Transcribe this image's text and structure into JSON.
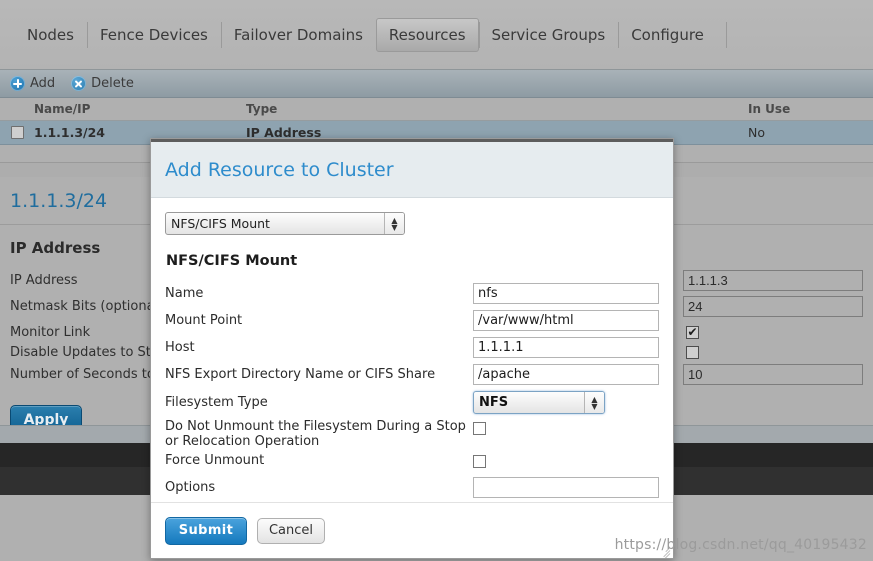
{
  "tabs": [
    {
      "label": "Nodes",
      "active": false
    },
    {
      "label": "Fence Devices",
      "active": false
    },
    {
      "label": "Failover Domains",
      "active": false
    },
    {
      "label": "Resources",
      "active": true
    },
    {
      "label": "Service Groups",
      "active": false
    },
    {
      "label": "Configure",
      "active": false
    }
  ],
  "toolbar": {
    "add_label": "Add",
    "delete_label": "Delete",
    "add_icon": "plus-circle-icon",
    "delete_icon": "x-circle-icon"
  },
  "table": {
    "columns": [
      "Name/IP",
      "Type",
      "In Use"
    ],
    "rows": [
      {
        "name": "1.1.1.3/24",
        "type": "IP Address",
        "in_use": "No",
        "selected": true,
        "checked": false
      }
    ]
  },
  "detail": {
    "title": "1.1.1.3/24",
    "section_title": "IP Address",
    "fields": [
      {
        "label": "IP Address",
        "type": "text",
        "value": "1.1.1.3"
      },
      {
        "label": "Netmask Bits (optional)",
        "type": "text",
        "value": "24"
      },
      {
        "label": "Monitor Link",
        "type": "checkbox",
        "checked": true
      },
      {
        "label": "Disable Updates to Static Routes",
        "type": "checkbox",
        "checked": false
      },
      {
        "label": "Number of Seconds to Sleep After Removing an IP Address",
        "type": "text",
        "value": "10"
      }
    ],
    "apply_label": "Apply"
  },
  "modal": {
    "title": "Add Resource to Cluster",
    "resource_type": {
      "selected": "NFS/CIFS Mount",
      "options": [
        "NFS/CIFS Mount"
      ]
    },
    "section_title": "NFS/CIFS Mount",
    "fields": [
      {
        "label": "Name",
        "type": "text",
        "value": "nfs"
      },
      {
        "label": "Mount Point",
        "type": "text",
        "value": "/var/www/html"
      },
      {
        "label": "Host",
        "type": "text",
        "value": "1.1.1.1"
      },
      {
        "label": "NFS Export Directory Name or CIFS Share",
        "type": "text",
        "value": "/apache"
      },
      {
        "label": "Filesystem Type",
        "type": "select",
        "value": "NFS",
        "options": [
          "NFS"
        ]
      },
      {
        "label": "Do Not Unmount the Filesystem During a Stop or Relocation Operation",
        "type": "checkbox",
        "checked": false
      },
      {
        "label": "Force Unmount",
        "type": "checkbox",
        "checked": false
      },
      {
        "label": "Options",
        "type": "text",
        "value": ""
      }
    ],
    "submit_label": "Submit",
    "cancel_label": "Cancel"
  },
  "watermark": "https://blog.csdn.net/qq_40195432",
  "colors": {
    "accent_blue": "#2e8ccc",
    "link_blue": "#1f6d9e",
    "submit_blue": "#1579bd",
    "panel_gray": "#b0b0b0",
    "row_selected": "#8ea3b0"
  }
}
